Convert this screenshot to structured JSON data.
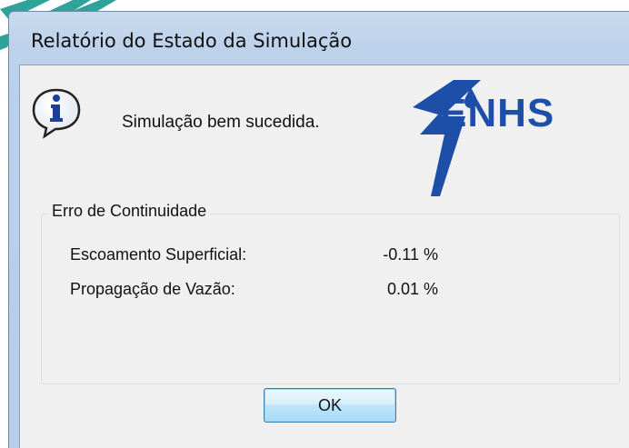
{
  "window": {
    "title": "Relatório do Estado da Simulação"
  },
  "message": {
    "text": "Simulação bem sucedida.",
    "icon": "info-icon"
  },
  "logo": {
    "text": "ENHS",
    "brand_color": "#1e4fa8"
  },
  "continuity": {
    "legend": "Erro de Continuidade",
    "rows": [
      {
        "label": "Escoamento Superficial:",
        "value": "-0.11 %"
      },
      {
        "label": "Propagação de Vazão:",
        "value": "0.01 %"
      }
    ]
  },
  "buttons": {
    "ok_label": "OK"
  },
  "colors": {
    "client_bg": "#f0f0f0",
    "title_bg": "#bcd1ea",
    "button_border": "#3c7fb1"
  }
}
